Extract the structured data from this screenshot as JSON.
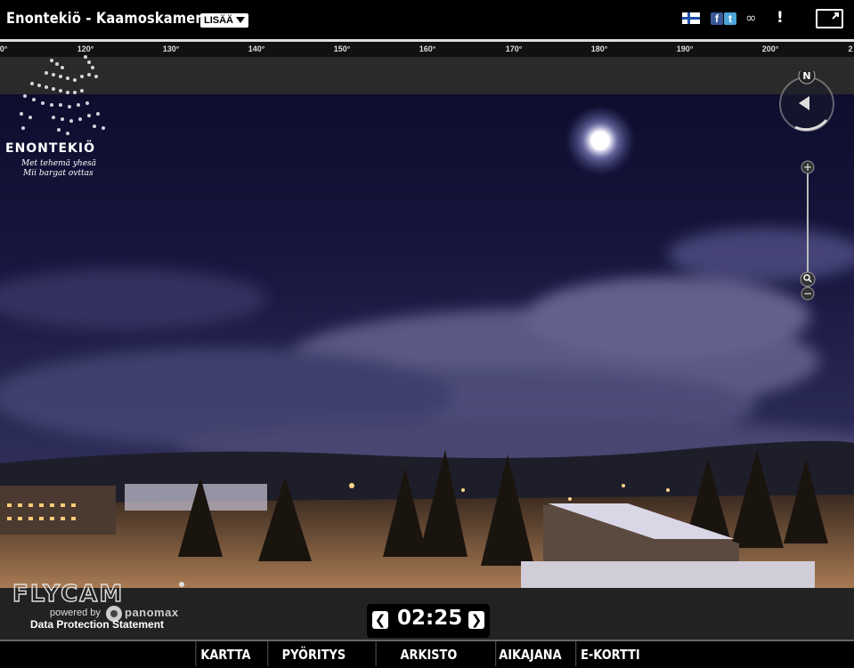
{
  "header": {
    "title": "Enontekiö - Kaamoskamera",
    "more_label": "LISÄÄ",
    "icons": [
      "finnish-flag-icon",
      "facebook-icon",
      "twitter-icon",
      "link-icon",
      "info-icon",
      "popout-icon"
    ],
    "fb_glyph": "f",
    "tw_glyph": "t",
    "link_glyph": "∞",
    "info_glyph": "!"
  },
  "ruler": {
    "ticks": [
      "0°",
      "120°",
      "130°",
      "140°",
      "150°",
      "160°",
      "170°",
      "180°",
      "190°",
      "200°",
      "2"
    ]
  },
  "logo": {
    "name": "ENONTEKIÖ",
    "tagline_1": "Met tehemä yhesä",
    "tagline_2": "Mii bargat ovttas"
  },
  "compass": {
    "north_label": "N"
  },
  "zoom": {
    "plus": "+",
    "minus": "−"
  },
  "footer": {
    "brand": "FLYCAM",
    "powered_by": "powered by",
    "panomax": "panomax",
    "data_protection": "Data Protection Statement",
    "time": "02:25",
    "prev_glyph": "❮",
    "next_glyph": "❯"
  },
  "nav": {
    "items": [
      "KARTTA",
      "PYÖRITYS",
      "ARKISTO",
      "AIKAJANA",
      "E-KORTTI"
    ]
  }
}
